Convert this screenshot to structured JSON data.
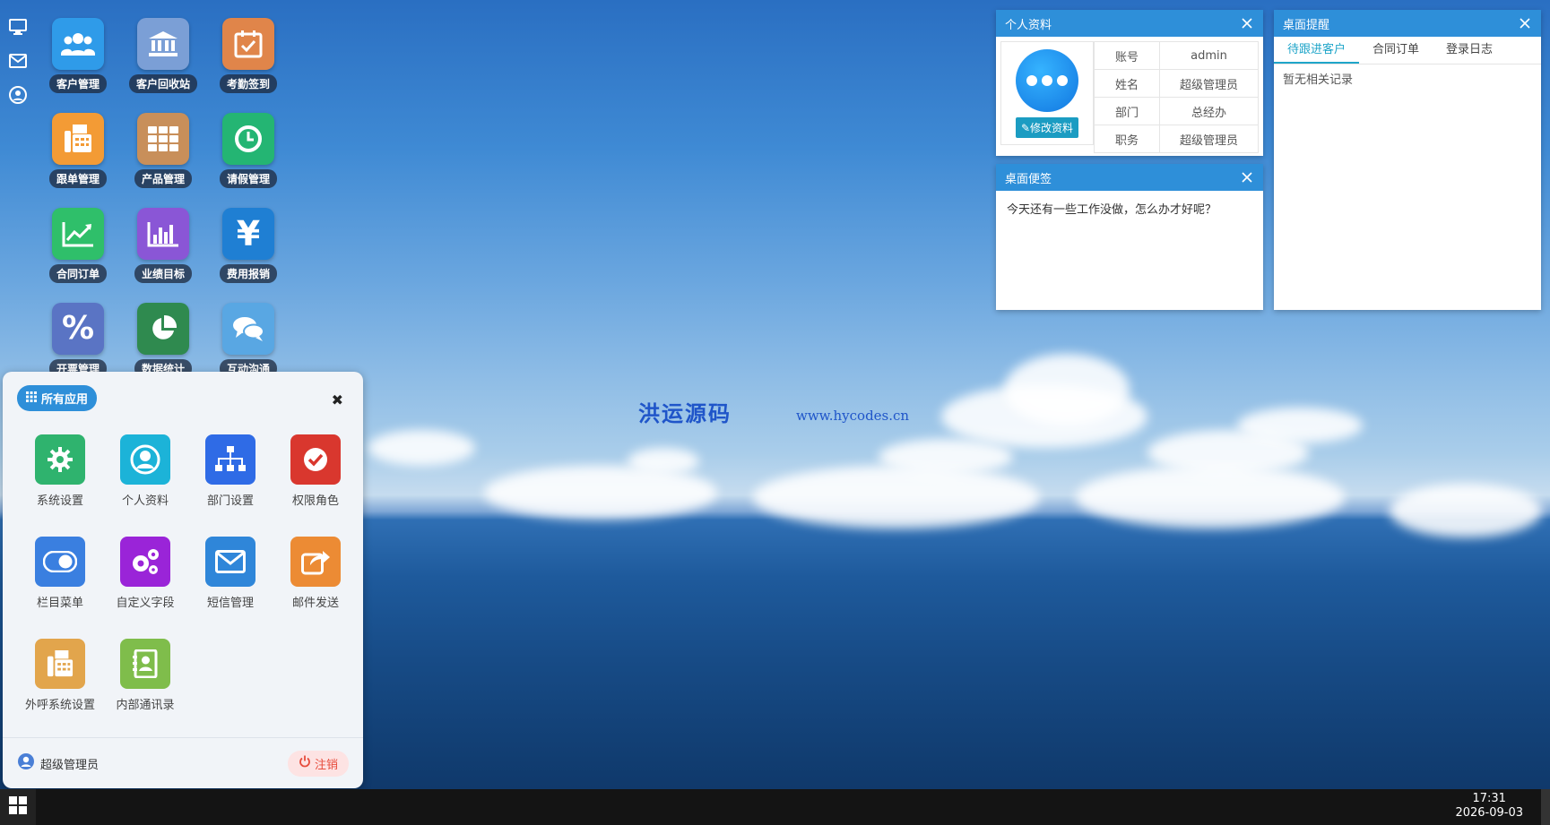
{
  "sidebar": {
    "items": [
      "monitor-icon",
      "mail-icon",
      "user-icon"
    ]
  },
  "desktop": {
    "icons": [
      {
        "label": "客户管理",
        "color": "#2f9be9",
        "icon": "users-icon"
      },
      {
        "label": "客户回收站",
        "color": "#7b9fd6",
        "icon": "bank-icon"
      },
      {
        "label": "考勤签到",
        "color": "#e0854a",
        "icon": "calendar-check-icon"
      },
      {
        "label": "跟单管理",
        "color": "#f39b35",
        "icon": "fax-icon"
      },
      {
        "label": "产品管理",
        "color": "#c88f5a",
        "icon": "grid-icon"
      },
      {
        "label": "请假管理",
        "color": "#24b573",
        "icon": "clock-icon"
      },
      {
        "label": "合同订单",
        "color": "#2fbf6a",
        "icon": "chart-line-icon"
      },
      {
        "label": "业绩目标",
        "color": "#8a56d6",
        "icon": "bar-chart-icon"
      },
      {
        "label": "费用报销",
        "color": "#1f7fd3",
        "icon": "yen-icon"
      },
      {
        "label": "开票管理",
        "color": "#5a74c4",
        "icon": "percent-icon"
      },
      {
        "label": "数据统计",
        "color": "#2f8a4f",
        "icon": "pie-icon"
      },
      {
        "label": "互动沟通",
        "color": "#59a7e3",
        "icon": "chat-icon"
      }
    ]
  },
  "profile": {
    "title": "个人资料",
    "edit_label": "修改资料",
    "rows": [
      {
        "key": "账号",
        "value": "admin"
      },
      {
        "key": "姓名",
        "value": "超级管理员"
      },
      {
        "key": "部门",
        "value": "总经办"
      },
      {
        "key": "职务",
        "value": "超级管理员"
      }
    ]
  },
  "note": {
    "title": "桌面便签",
    "text": "今天还有一些工作没做，怎么办才好呢？"
  },
  "reminder": {
    "title": "桌面提醒",
    "tabs": [
      "待跟进客户",
      "合同订单",
      "登录日志"
    ],
    "empty": "暂无相关记录"
  },
  "watermark": {
    "cn": "洪运源码",
    "url": "www.hycodes.cn"
  },
  "start_menu": {
    "header": "所有应用",
    "apps": [
      {
        "label": "系统设置",
        "color": "#2fb36e",
        "icon": "gear-icon"
      },
      {
        "label": "个人资料",
        "color": "#1cb3d8",
        "icon": "user-circle-icon"
      },
      {
        "label": "部门设置",
        "color": "#2f6be6",
        "icon": "org-chart-icon"
      },
      {
        "label": "权限角色",
        "color": "#d9372e",
        "icon": "check-circle-icon"
      },
      {
        "label": "栏目菜单",
        "color": "#3a7fe0",
        "icon": "toggle-icon"
      },
      {
        "label": "自定义字段",
        "color": "#9a24d8",
        "icon": "gears-icon"
      },
      {
        "label": "短信管理",
        "color": "#2f86d9",
        "icon": "envelope-icon"
      },
      {
        "label": "邮件发送",
        "color": "#ec8b34",
        "icon": "share-icon"
      },
      {
        "label": "外呼系统设置",
        "color": "#e2a54c",
        "icon": "fax-icon"
      },
      {
        "label": "内部通讯录",
        "color": "#7fbd4b",
        "icon": "contacts-icon"
      }
    ],
    "user": "超级管理员",
    "logout": "注销"
  },
  "taskbar": {
    "time": "17:31",
    "date": "2026-09-03"
  }
}
